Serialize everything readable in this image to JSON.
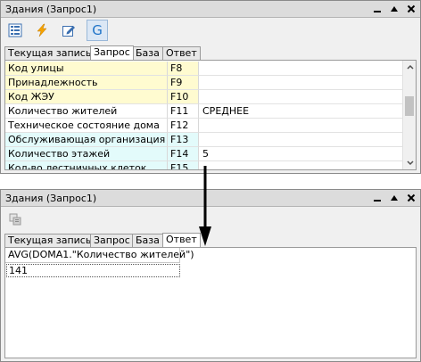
{
  "window_top": {
    "title": "Здания (Запрос1)",
    "tabs": [
      {
        "label": "Текущая запись"
      },
      {
        "label": "Запрос"
      },
      {
        "label": "База"
      },
      {
        "label": "Ответ"
      }
    ],
    "selected_tab": "Запрос",
    "rows": [
      {
        "name": "Код улицы",
        "field": "F8",
        "value": "",
        "color": "yellow"
      },
      {
        "name": "Принадлежность",
        "field": "F9",
        "value": "",
        "color": "yellow"
      },
      {
        "name": "Код ЖЭУ",
        "field": "F10",
        "value": "",
        "color": "yellow"
      },
      {
        "name": "Количество жителей",
        "field": "F11",
        "value": "СРЕДНЕЕ",
        "color": "white"
      },
      {
        "name": "Техническое состояние дома",
        "field": "F12",
        "value": "",
        "color": "white"
      },
      {
        "name": "Обслуживающая организация",
        "field": "F13",
        "value": "",
        "color": "cyan"
      },
      {
        "name": "Количество этажей",
        "field": "F14",
        "value": "5",
        "color": "cyan"
      },
      {
        "name": "Кол-во лестничных клеток",
        "field": "F15",
        "value": "",
        "color": "cyan"
      }
    ]
  },
  "window_bottom": {
    "title": "Здания (Запрос1)",
    "tabs": [
      {
        "label": "Текущая запись"
      },
      {
        "label": "Запрос"
      },
      {
        "label": "База"
      },
      {
        "label": "Ответ"
      }
    ],
    "selected_tab": "Ответ",
    "result_header": "AVG(DOMA1.\"Количество жителей\")",
    "result_value": "141"
  },
  "colors": {
    "yellow_row": "#fffbd0",
    "cyan_row": "#e3fbfb",
    "lightning": "#f5a300",
    "accent_blue": "#1e73c8"
  },
  "icons": [
    "grid-icon",
    "lightning-icon",
    "edit-icon",
    "g-icon",
    "minimize-icon",
    "maximize-icon",
    "close-icon",
    "refresh-icon"
  ]
}
